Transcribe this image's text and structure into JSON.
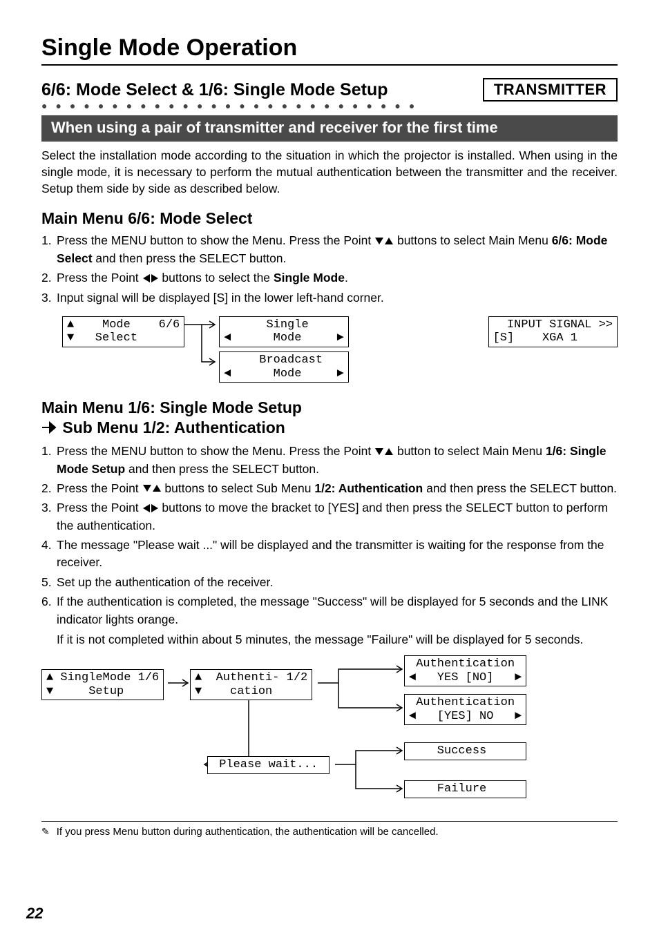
{
  "pageTitle": "Single Mode Operation",
  "sectionTitle": "6/6: Mode Select & 1/6: Single Mode Setup",
  "badge": "TRANSMITTER",
  "dots": "●●●●●●●●●●●●●●●●●●●●●●●●●●●",
  "banner": "When using a pair of transmitter and receiver for the first time",
  "intro": "Select the installation mode according to the situation in which the projector is installed. When using in the single mode, it is necessary to perform the mutual authentication between the transmitter and the receiver. Setup them side by side as described below.",
  "modeSelect": {
    "title": "Main Menu 6/6: Mode Select",
    "items": {
      "n1": "1.",
      "t1a": "Press the MENU button to show the Menu. Press the Point ",
      "t1b": " buttons to select Main Menu ",
      "t1bold": "6/6: Mode Select",
      "t1c": " and then press the SELECT button.",
      "n2": "2.",
      "t2a": "Press the Point ",
      "t2b": " buttons to select the ",
      "t2bold": "Single Mode",
      "t2c": ".",
      "n3": "3.",
      "t3": "Input signal will be displayed [S] in the lower left-hand corner."
    },
    "lcd": {
      "box1": "▲    Mode    6/6\n▼   Select      ",
      "box2": "      Single     \n◄      Mode     ►",
      "box3": "     Broadcast   \n◄      Mode     ►",
      "box4": "  INPUT SIGNAL >>\n[S]    XGA 1     "
    }
  },
  "singleSetup": {
    "title1": "Main Menu 1/6: Single Mode Setup",
    "title2": " Sub Menu 1/2: Authentication",
    "items": {
      "n1": "1.",
      "t1a": "Press the MENU button to show the Menu. Press the Point ",
      "t1b": " button to select Main Menu ",
      "t1bold": "1/6: Single Mode Setup",
      "t1c": " and then press the SELECT button.",
      "n2": "2.",
      "t2a": "Press the Point ",
      "t2b": " buttons to select Sub Menu ",
      "t2bold": "1/2: Authentication",
      "t2c": " and then press the SELECT button.",
      "n3": "3.",
      "t3a": "Press the Point ",
      "t3b": " buttons to move the bracket to [YES] and then press the SELECT button to perform the authentication.",
      "n4": "4.",
      "t4": "The message \"Please wait ...\" will be displayed and the transmitter is waiting for the response from the receiver.",
      "n5": "5.",
      "t5": "Set up the authentication of the receiver.",
      "n6": "6.",
      "t6": "If the authentication is completed, the message \"Success\" will be displayed for 5 seconds and the LINK indicator lights orange.",
      "t6b": "If it is not completed within about 5 minutes, the message \"Failure\" will be displayed for 5 seconds."
    },
    "lcd": {
      "b1": "▲ SingleMode 1/6\n▼     Setup     ",
      "b2": "▲  Authenti- 1/2\n▼    cation     ",
      "b3": " Authentication \n◄   YES [NO]   ►",
      "b4": " Authentication \n◄   [YES] NO   ►",
      "b5": " Please wait... ",
      "b6": "    Success     ",
      "b7": "    Failure     "
    }
  },
  "footnote": "If you press Menu button during authentication, the authentication will be cancelled.",
  "pageNum": "22"
}
